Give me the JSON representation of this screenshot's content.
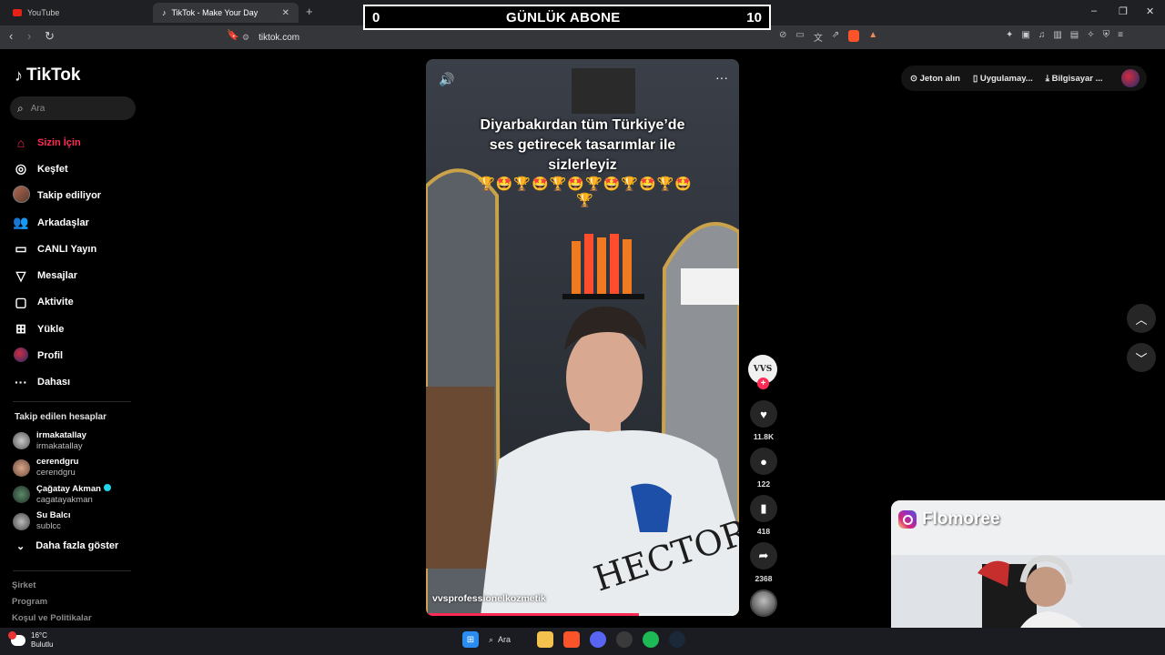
{
  "browser": {
    "tabs": [
      {
        "title": "YouTube"
      },
      {
        "title": "TikTok - Make Your Day"
      }
    ],
    "url": "tiktok.com",
    "window_controls": [
      "–",
      "❐",
      "✕"
    ]
  },
  "overlay_counter": {
    "left": "0",
    "title": "GÜNLÜK ABONE",
    "right": "10"
  },
  "tiktok": {
    "logo": "TikTok",
    "search_placeholder": "Ara",
    "nav": [
      {
        "label": "Sizin İçin",
        "icon": "home-icon",
        "active": true
      },
      {
        "label": "Keşfet",
        "icon": "compass-icon"
      },
      {
        "label": "Takip ediliyor",
        "icon": "following-avatar"
      },
      {
        "label": "Arkadaşlar",
        "icon": "friends-icon"
      },
      {
        "label": "CANLI Yayın",
        "icon": "live-icon"
      },
      {
        "label": "Mesajlar",
        "icon": "messages-icon"
      },
      {
        "label": "Aktivite",
        "icon": "activity-icon"
      },
      {
        "label": "Yükle",
        "icon": "upload-icon"
      },
      {
        "label": "Profil",
        "icon": "profile-avatar"
      },
      {
        "label": "Dahası",
        "icon": "more-icon"
      }
    ],
    "following_title": "Takip edilen hesaplar",
    "following": [
      {
        "name": "irmakatallay",
        "handle": "irmakatallay"
      },
      {
        "name": "cerendgru",
        "handle": "cerendgru"
      },
      {
        "name": "Çağatay Akman",
        "handle": "cagatayakman",
        "verified": true
      },
      {
        "name": "Su Balcı",
        "handle": "sublcc"
      }
    ],
    "show_more": "Daha fazla göster",
    "footer": [
      "Şirket",
      "Program",
      "Koşul ve Politikalar"
    ],
    "top_links": [
      "Jeton alın",
      "Uygulamay...",
      "Bilgisayar ..."
    ],
    "video": {
      "caption_lines": [
        "Diyarbakırdan tüm Türkiye’de",
        "ses getirecek tasarımlar ile",
        "sizlerleyiz"
      ],
      "emojis": "🏆🤩🏆🤩🏆🤩🏆🤩🏆🤩🏆🤩🏆",
      "author": "vvsprofessionelkozmetik",
      "apron_text": "HECTOR",
      "progress": 0.68
    },
    "actions": {
      "creator_badge": "VVS",
      "likes": "11.8K",
      "comments": "122",
      "saves": "418",
      "shares": "2368"
    }
  },
  "webcam": {
    "instagram_name": "Flomoree"
  },
  "taskbar": {
    "temperature": "16°C",
    "condition": "Bulutlu",
    "search_label": "Ara"
  }
}
